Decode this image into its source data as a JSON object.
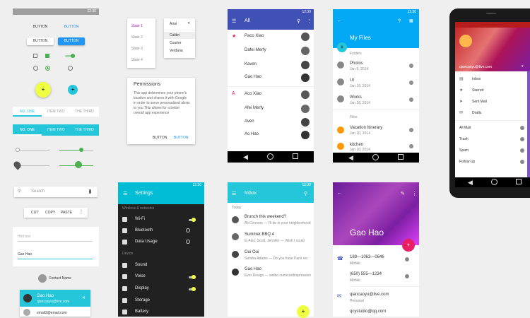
{
  "statusbar": {
    "time": "12:30"
  },
  "buttons": {
    "flat": "BUTTON",
    "flat_blue": "BUTTON",
    "raised": "BUTTON",
    "raised_blue": "BUTTON"
  },
  "tabs1": [
    "NO. ONE",
    "ITEM TWO",
    "THE THIRD"
  ],
  "tabs2": [
    "NO. ONE",
    "ITEM TWO",
    "THE THIRD"
  ],
  "states": [
    "State 1",
    "State 2",
    "State 3",
    "State 4"
  ],
  "fonts": {
    "selected": "Arial",
    "options": [
      "Calibri",
      "Courier",
      "Verdana"
    ]
  },
  "dialog": {
    "title": "Permissions",
    "body": "This app determines your phone's location and shares it with Google in order to serve personalized alerts to you This allows for a better overall app experience",
    "btn1": "BUTTON",
    "btn2": "BUTTON"
  },
  "search": {
    "placeholder": "Search"
  },
  "copybar": [
    "CUT",
    "COPY",
    "PASTE"
  ],
  "fields": {
    "hint": "Hint text",
    "value": "Gao Hao"
  },
  "contact": {
    "name": "Contact Name"
  },
  "account": {
    "name": "Gao Hao",
    "email": "qiancaoyu@live.com",
    "email2": "email2@email.com"
  },
  "contacts": {
    "title": "All",
    "items": [
      "Paco Xiao",
      "Dafei Merfy",
      "Kaven",
      "Gao Hao",
      "Aco Xiao",
      "Afei Merfy",
      "Aven",
      "Ao Hao"
    ],
    "letters": [
      "★",
      "A"
    ]
  },
  "files": {
    "title": "My Files",
    "folders_label": "Folders",
    "files_label": "Files",
    "folders": [
      {
        "name": "Photos",
        "date": "Jan 9, 2014"
      },
      {
        "name": "UI",
        "date": "Jan 18, 2014"
      },
      {
        "name": "Works",
        "date": "Jan 28, 2014"
      }
    ],
    "files": [
      {
        "name": "Vacation Itinerary",
        "date": "Jan 20, 2014"
      },
      {
        "name": "kitchen",
        "date": "Jan 10, 2014"
      }
    ]
  },
  "drawer": {
    "email": "qiancaoyu@live.com",
    "items": [
      "Inbox",
      "Starred",
      "Sent Mail",
      "Drafts"
    ],
    "items2": [
      "All Mail",
      "Trash",
      "Spam",
      "Follow Up"
    ]
  },
  "settings": {
    "title": "Settings",
    "section1": "Wireless & networks",
    "items1": [
      "Wi-Fi",
      "Bluetooth",
      "Data Usage"
    ],
    "section2": "Device",
    "items2": [
      "Sound",
      "Voice",
      "Display",
      "Storage",
      "Battery"
    ]
  },
  "inbox": {
    "title": "Inbox",
    "section": "Today",
    "items": [
      {
        "title": "Brunch this weekend?",
        "sub": "Ali Connors — I'll be in your neighborhood"
      },
      {
        "title": "Summer BBQ 4",
        "sub": "to Alex, Scott, Jennifer — Wish I could"
      },
      {
        "title": "Oui Oui",
        "sub": "Sandra Adams — Do you have Paris rec"
      },
      {
        "title": "Gao Hao",
        "sub": "Ever Design — weibo.com/cardimpression"
      }
    ]
  },
  "profile": {
    "name": "Gao Hao",
    "phones": [
      {
        "num": "189—1063—0646",
        "label": "Mobile"
      },
      {
        "num": "(650) 555—1234",
        "label": "Mobile"
      }
    ],
    "emails": [
      {
        "addr": "qiancaoyu@live.com",
        "label": "Personal"
      },
      {
        "addr": "qcystudio@qq.com",
        "label": ""
      }
    ]
  },
  "colors": {
    "blue": "#2196f3",
    "cyan": "#26c6da",
    "indigo": "#3f51b5",
    "purple": "#9c27b0",
    "pink": "#e91e63",
    "green": "#4caf50",
    "yellow": "#eeff41",
    "dark": "#212121"
  }
}
